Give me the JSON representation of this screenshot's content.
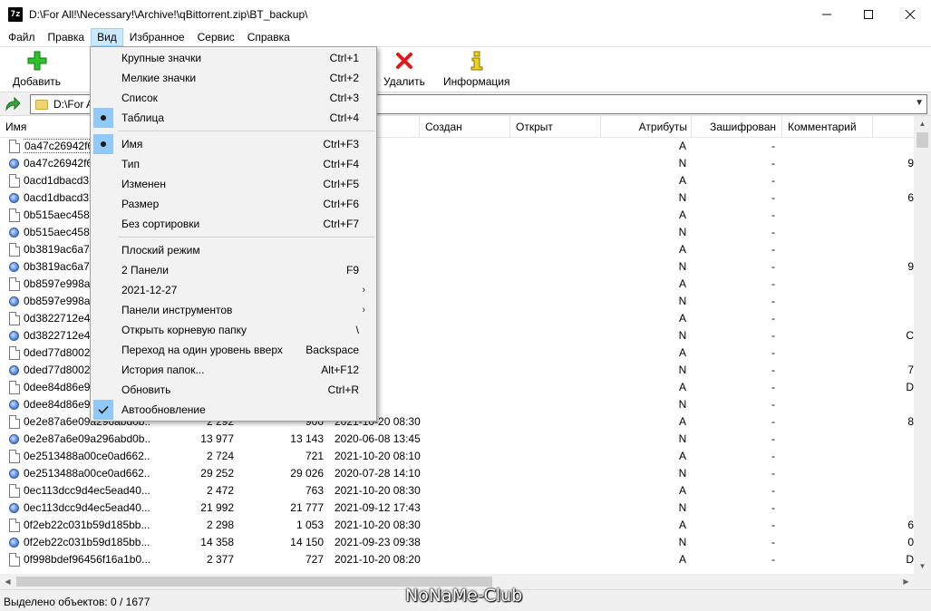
{
  "window": {
    "app_icon_text": "7z",
    "title": "D:\\For All!\\Necessary!\\Archive!\\qBittorrent.zip\\BT_backup\\"
  },
  "menu": [
    "Файл",
    "Правка",
    "Вид",
    "Избранное",
    "Сервис",
    "Справка"
  ],
  "toolbar": {
    "add": "Добавить",
    "delete": "Удалить",
    "info": "Информация"
  },
  "address": {
    "value": "D:\\For A"
  },
  "columns": [
    "Имя",
    "Создан",
    "Открыт",
    "Атрибуты",
    "Зашифрован",
    "Комментарий"
  ],
  "rows": [
    {
      "name": "0a47c26942f60",
      "icon": "doc",
      "size": "",
      "packed": "",
      "modified": "20 08:30",
      "attr": "A",
      "enc": "-",
      "tail": ""
    },
    {
      "name": "0a47c26942f60",
      "icon": "gear",
      "size": "",
      "packed": "",
      "modified": "06 21:40",
      "attr": "N",
      "enc": "-",
      "tail": "9"
    },
    {
      "name": "0acd1dbacd32",
      "icon": "doc",
      "size": "",
      "packed": "",
      "modified": "20 08:25",
      "attr": "A",
      "enc": "-",
      "tail": ""
    },
    {
      "name": "0acd1dbacd32",
      "icon": "gear",
      "size": "",
      "packed": "",
      "modified": "09 15:36",
      "attr": "N",
      "enc": "-",
      "tail": "6"
    },
    {
      "name": "0b515aec458d",
      "icon": "doc",
      "size": "",
      "packed": "",
      "modified": "20 08:00",
      "attr": "A",
      "enc": "-",
      "tail": ""
    },
    {
      "name": "0b515aec458d",
      "icon": "gear",
      "size": "",
      "packed": "",
      "modified": "20 13:47",
      "attr": "N",
      "enc": "-",
      "tail": ""
    },
    {
      "name": "0b3819ac6a7c",
      "icon": "doc",
      "size": "",
      "packed": "",
      "modified": "20 07:55",
      "attr": "A",
      "enc": "-",
      "tail": ""
    },
    {
      "name": "0b3819ac6a7c",
      "icon": "gear",
      "size": "",
      "packed": "",
      "modified": "15 18:56",
      "attr": "N",
      "enc": "-",
      "tail": "9"
    },
    {
      "name": "0b8597e998a7",
      "icon": "doc",
      "size": "",
      "packed": "",
      "modified": "20 08:30",
      "attr": "A",
      "enc": "-",
      "tail": ""
    },
    {
      "name": "0b8597e998a7",
      "icon": "gear",
      "size": "",
      "packed": "",
      "modified": "12 18:02",
      "attr": "N",
      "enc": "-",
      "tail": ""
    },
    {
      "name": "0d3822712e42",
      "icon": "doc",
      "size": "",
      "packed": "",
      "modified": "20 08:30",
      "attr": "A",
      "enc": "-",
      "tail": ""
    },
    {
      "name": "0d3822712e42",
      "icon": "gear",
      "size": "",
      "packed": "",
      "modified": "07 20:42",
      "attr": "N",
      "enc": "-",
      "tail": "C"
    },
    {
      "name": "0ded77d80024",
      "icon": "doc",
      "size": "",
      "packed": "",
      "modified": "20 07:55",
      "attr": "A",
      "enc": "-",
      "tail": ""
    },
    {
      "name": "0ded77d80024",
      "icon": "gear",
      "size": "",
      "packed": "",
      "modified": "08 13:44",
      "attr": "N",
      "enc": "-",
      "tail": "7"
    },
    {
      "name": "0dee84d86e95",
      "icon": "doc",
      "size": "",
      "packed": "",
      "modified": "20 08:20",
      "attr": "A",
      "enc": "-",
      "tail": "D"
    },
    {
      "name": "0dee84d86e95",
      "icon": "gear",
      "size": "",
      "packed": "",
      "modified": "08 13:45",
      "attr": "N",
      "enc": "-",
      "tail": ""
    },
    {
      "name": "0e2e87a6e09a296abd0b...",
      "icon": "doc",
      "size": "2 292",
      "packed": "900",
      "modified": "2021-10-20 08:30",
      "attr": "A",
      "enc": "-",
      "tail": "8"
    },
    {
      "name": "0e2e87a6e09a296abd0b...",
      "icon": "gear",
      "size": "13 977",
      "packed": "13 143",
      "modified": "2020-06-08 13:45",
      "attr": "N",
      "enc": "-",
      "tail": ""
    },
    {
      "name": "0e2513488a00ce0ad662...",
      "icon": "doc",
      "size": "2 724",
      "packed": "721",
      "modified": "2021-10-20 08:10",
      "attr": "A",
      "enc": "-",
      "tail": ""
    },
    {
      "name": "0e2513488a00ce0ad662...",
      "icon": "gear",
      "size": "29 252",
      "packed": "29 026",
      "modified": "2020-07-28 14:10",
      "attr": "N",
      "enc": "-",
      "tail": ""
    },
    {
      "name": "0ec113dcc9d4ec5ead40...",
      "icon": "doc",
      "size": "2 472",
      "packed": "763",
      "modified": "2021-10-20 08:30",
      "attr": "A",
      "enc": "-",
      "tail": ""
    },
    {
      "name": "0ec113dcc9d4ec5ead40...",
      "icon": "gear",
      "size": "21 992",
      "packed": "21 777",
      "modified": "2021-09-12 17:43",
      "attr": "N",
      "enc": "-",
      "tail": ""
    },
    {
      "name": "0f2eb22c031b59d185bb...",
      "icon": "doc",
      "size": "2 298",
      "packed": "1 053",
      "modified": "2021-10-20 08:30",
      "attr": "A",
      "enc": "-",
      "tail": "6"
    },
    {
      "name": "0f2eb22c031b59d185bb...",
      "icon": "gear",
      "size": "14 358",
      "packed": "14 150",
      "modified": "2021-09-23 09:38",
      "attr": "N",
      "enc": "-",
      "tail": "0"
    },
    {
      "name": "0f998bdef96456f16a1b0...",
      "icon": "doc",
      "size": "2 377",
      "packed": "727",
      "modified": "2021-10-20 08:20",
      "attr": "A",
      "enc": "-",
      "tail": "D"
    }
  ],
  "view_menu": [
    {
      "label": "Крупные значки",
      "shortcut": "Ctrl+1",
      "mark": ""
    },
    {
      "label": "Мелкие значки",
      "shortcut": "Ctrl+2",
      "mark": ""
    },
    {
      "label": "Список",
      "shortcut": "Ctrl+3",
      "mark": ""
    },
    {
      "label": "Таблица",
      "shortcut": "Ctrl+4",
      "mark": "bullet"
    },
    {
      "sep": true
    },
    {
      "label": "Имя",
      "shortcut": "Ctrl+F3",
      "mark": "bullet"
    },
    {
      "label": "Тип",
      "shortcut": "Ctrl+F4",
      "mark": ""
    },
    {
      "label": "Изменен",
      "shortcut": "Ctrl+F5",
      "mark": ""
    },
    {
      "label": "Размер",
      "shortcut": "Ctrl+F6",
      "mark": ""
    },
    {
      "label": "Без сортировки",
      "shortcut": "Ctrl+F7",
      "mark": ""
    },
    {
      "sep": true
    },
    {
      "label": "Плоский режим",
      "shortcut": "",
      "mark": ""
    },
    {
      "label": "2 Панели",
      "shortcut": "F9",
      "mark": ""
    },
    {
      "label": "2021-12-27",
      "shortcut": "",
      "mark": "",
      "submenu": true
    },
    {
      "label": "Панели инструментов",
      "shortcut": "",
      "mark": "",
      "submenu": true
    },
    {
      "label": "Открыть корневую папку",
      "shortcut": "\\",
      "mark": ""
    },
    {
      "label": "Переход на один уровень вверх",
      "shortcut": "Backspace",
      "mark": ""
    },
    {
      "label": "История папок...",
      "shortcut": "Alt+F12",
      "mark": ""
    },
    {
      "label": "Обновить",
      "shortcut": "Ctrl+R",
      "mark": ""
    },
    {
      "label": "Автообновление",
      "shortcut": "",
      "mark": "check"
    }
  ],
  "status": {
    "selected": "Выделено объектов: 0 / 1677"
  },
  "watermark": "NoNaMe-Club"
}
